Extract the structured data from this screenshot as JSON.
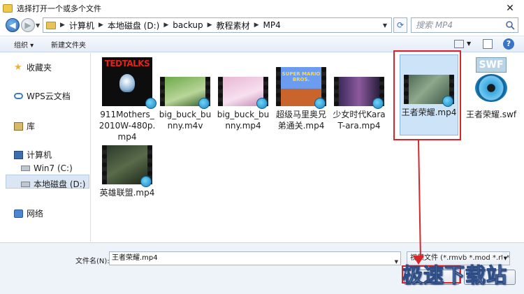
{
  "window": {
    "title": "选择打开一个或多个文件",
    "close_glyph": "✕"
  },
  "address": {
    "crumbs": [
      "计算机",
      "本地磁盘 (D:)",
      "backup",
      "教程素材",
      "MP4"
    ],
    "search_placeholder": "搜索 MP4"
  },
  "toolbar": {
    "organize": "组织 ▾",
    "new_folder": "新建文件夹",
    "help": "?"
  },
  "sidebar": {
    "favorites": "收藏夹",
    "wps": "WPS云文档",
    "library": "库",
    "computer": "计算机",
    "drive_c": "Win7 (C:)",
    "drive_d": "本地磁盘 (D:)",
    "network": "网络"
  },
  "files": [
    {
      "label": "911Mothers_2010W-480p.mp4",
      "thumb": "tedtalks",
      "thumb_text": "TEDTALKS"
    },
    {
      "label": "big_buck_bunny.m4v",
      "thumb": "bunny"
    },
    {
      "label": "big_buck_bunny.mp4",
      "thumb": "bunny2"
    },
    {
      "label": "超级马里奥兄弟通关.mp4",
      "thumb": "mario",
      "thumb_text": "SUPER MARIO BROS."
    },
    {
      "label": "少女时代KaraT-ara.mp4",
      "thumb": "kpop"
    },
    {
      "label": "王者荣耀.mp4",
      "thumb": "game",
      "selected": true
    },
    {
      "label": "王者荣耀.swf",
      "thumb": "swf",
      "thumb_text": "SWF"
    },
    {
      "label": "英雄联盟.mp4",
      "thumb": "lol"
    }
  ],
  "bottom": {
    "filename_label": "文件名(N):",
    "filename_value": "王者荣耀.mp4",
    "filetype_value": "视频文件 (*.rmvb *.mod *.rt *"
  },
  "watermark": "极速下载站",
  "colors": {
    "annotation": "#d9252a",
    "selection": "#cde3f7"
  }
}
